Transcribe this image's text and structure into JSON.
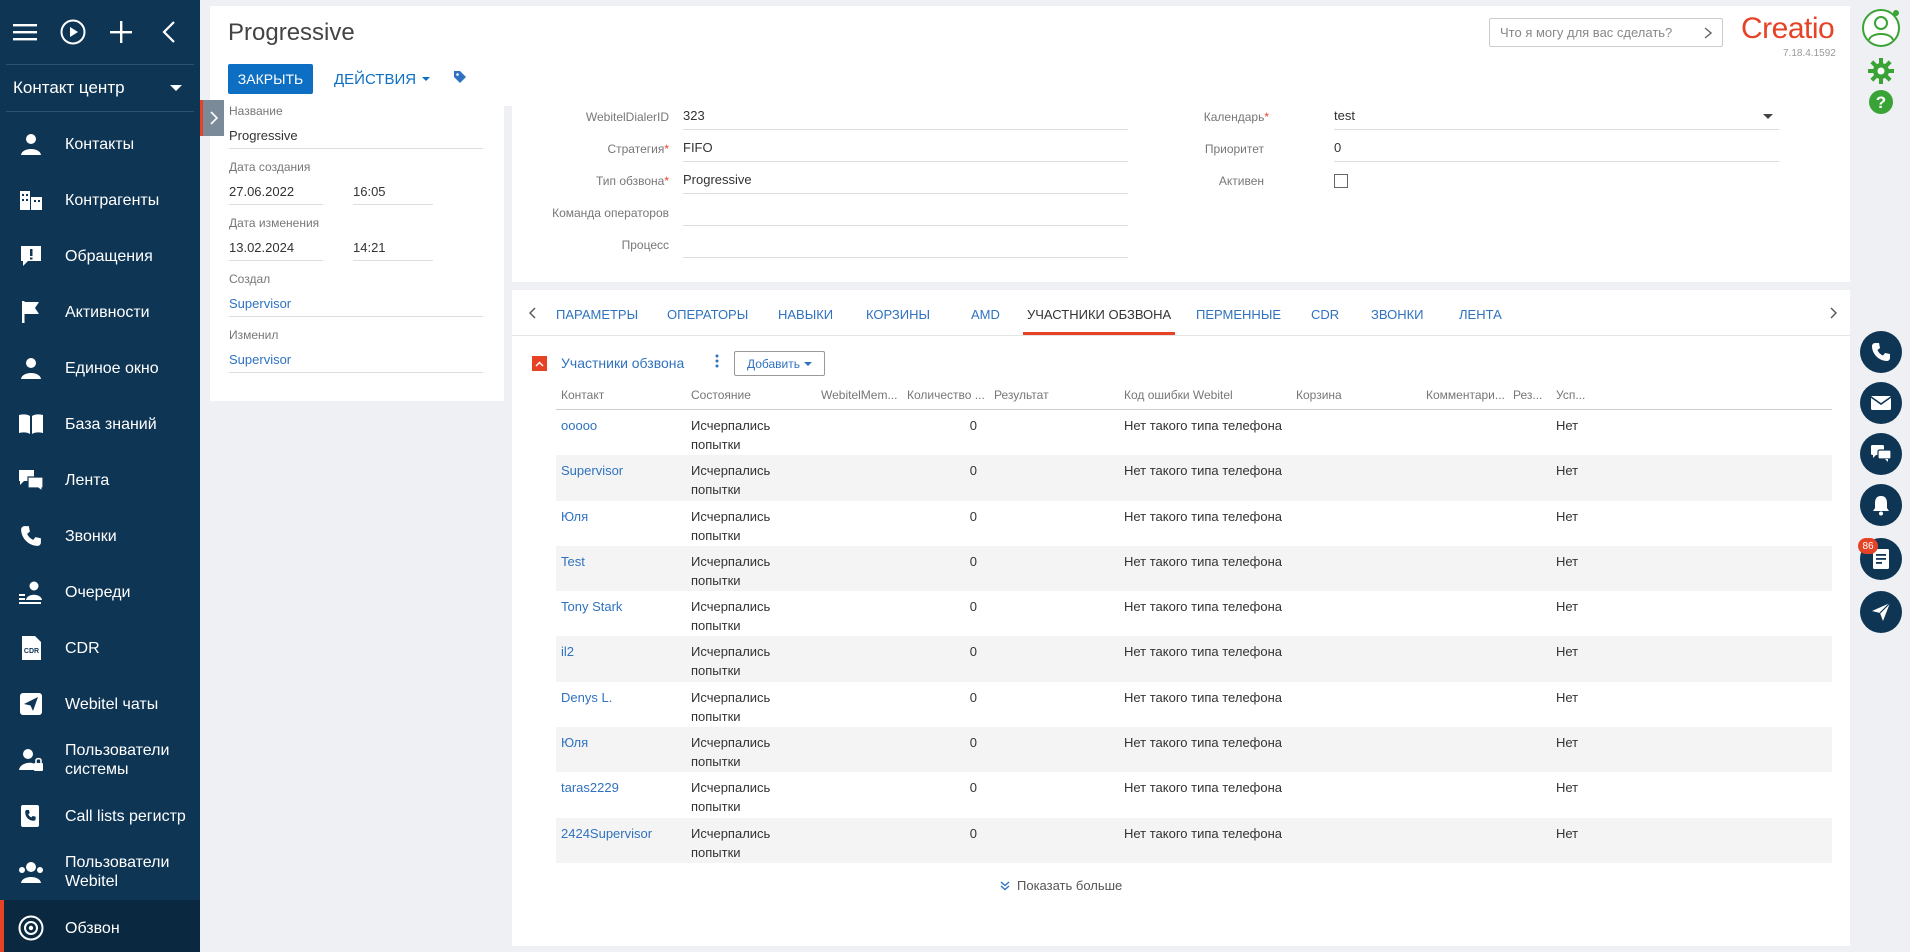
{
  "sidebar": {
    "workplace": "Контакт центр",
    "items": [
      {
        "label": "Контакты",
        "icon": "contact-icon"
      },
      {
        "label": "Контрагенты",
        "icon": "account-icon"
      },
      {
        "label": "Обращения",
        "icon": "case-icon"
      },
      {
        "label": "Активности",
        "icon": "flag-icon"
      },
      {
        "label": "Единое окно",
        "icon": "person-icon"
      },
      {
        "label": "База знаний",
        "icon": "book-icon"
      },
      {
        "label": "Лента",
        "icon": "feed-icon"
      },
      {
        "label": "Звонки",
        "icon": "phone-icon"
      },
      {
        "label": "Очереди",
        "icon": "queue-icon"
      },
      {
        "label": "CDR",
        "icon": "cdr-icon"
      },
      {
        "label": "Webitel чаты",
        "icon": "send-icon"
      },
      {
        "label": "Пользователи системы",
        "icon": "user-lock-icon"
      },
      {
        "label": "Call lists регистр",
        "icon": "phone-list-icon"
      },
      {
        "label": "Пользователи Webitel",
        "icon": "users-icon"
      },
      {
        "label": "Обзвон",
        "icon": "dialer-icon",
        "active": true
      }
    ]
  },
  "header": {
    "title": "Progressive",
    "close_label": "ЗАКРЫТЬ",
    "actions_label": "ДЕЙСТВИЯ",
    "search_placeholder": "Что я могу для вас сделать?",
    "logo": "Creatio",
    "version": "7.18.4.1592"
  },
  "info": {
    "name_label": "Название",
    "name_value": "Progressive",
    "created_label": "Дата создания",
    "created_date": "27.06.2022",
    "created_time": "16:05",
    "modified_label": "Дата изменения",
    "modified_date": "13.02.2024",
    "modified_time": "14:21",
    "created_by_label": "Создал",
    "created_by": "Supervisor",
    "modified_by_label": "Изменил",
    "modified_by": "Supervisor"
  },
  "form": {
    "dialer_id_label": "WebitelDialerID",
    "dialer_id_value": "323",
    "strategy_label": "Стратегия",
    "strategy_value": "FIFO",
    "type_label": "Тип обзвона",
    "type_value": "Progressive",
    "team_label": "Команда операторов",
    "team_value": "",
    "process_label": "Процесс",
    "process_value": "",
    "calendar_label": "Календарь",
    "calendar_value": "test",
    "priority_label": "Приоритет",
    "priority_value": "0",
    "active_label": "Активен",
    "active_checked": false
  },
  "tabs": [
    "ПАРАМЕТРЫ",
    "ОПЕРАТОРЫ",
    "НАВЫКИ",
    "КОРЗИНЫ",
    "AMD",
    "УЧАСТНИКИ ОБЗВОНА",
    "ПЕРМЕННЫЕ",
    "CDR",
    "ЗВОНКИ",
    "ЛЕНТА"
  ],
  "active_tab": "УЧАСТНИКИ ОБЗВОНА",
  "detail": {
    "title": "Участники обзвона",
    "add_label": "Добавить",
    "show_more": "Показать больше",
    "columns": [
      "Контакт",
      "Состояние",
      "WebitelMem...",
      "Количество ...",
      "Результат",
      "Код ошибки Webitel",
      "Корзина",
      "Комментари...",
      "Рез...",
      "Усп..."
    ],
    "rows": [
      {
        "contact": "ooooo",
        "state_1": "Исчерпались",
        "state_2": "попытки",
        "count": "0",
        "error": "Нет такого типа телефона",
        "success": "Нет"
      },
      {
        "contact": "Supervisor",
        "state_1": "Исчерпались",
        "state_2": "попытки",
        "count": "0",
        "error": "Нет такого типа телефона",
        "success": "Нет"
      },
      {
        "contact": "Юля",
        "state_1": "Исчерпались",
        "state_2": "попытки",
        "count": "0",
        "error": "Нет такого типа телефона",
        "success": "Нет"
      },
      {
        "contact": "Test",
        "state_1": "Исчерпались",
        "state_2": "попытки",
        "count": "0",
        "error": "Нет такого типа телефона",
        "success": "Нет"
      },
      {
        "contact": "Tony Stark",
        "state_1": "Исчерпались",
        "state_2": "попытки",
        "count": "0",
        "error": "Нет такого типа телефона",
        "success": "Нет"
      },
      {
        "contact": "il2",
        "state_1": "Исчерпались",
        "state_2": "попытки",
        "count": "0",
        "error": "Нет такого типа телефона",
        "success": "Нет"
      },
      {
        "contact": "Denys L.",
        "state_1": "Исчерпались",
        "state_2": "попытки",
        "count": "0",
        "error": "Нет такого типа телефона",
        "success": "Нет"
      },
      {
        "contact": "Юля",
        "state_1": "Исчерпались",
        "state_2": "попытки",
        "count": "0",
        "error": "Нет такого типа телефона",
        "success": "Нет"
      },
      {
        "contact": "taras2229",
        "state_1": "Исчерпались",
        "state_2": "попытки",
        "count": "0",
        "error": "Нет такого типа телефона",
        "success": "Нет"
      },
      {
        "contact": "2424Supervisor",
        "state_1": "Исчерпались",
        "state_2": "попытки",
        "count": "0",
        "error": "Нет такого типа телефона",
        "success": "Нет"
      }
    ]
  },
  "right_panel": {
    "notification_count": "86"
  },
  "colors": {
    "sidebar": "#0f3554",
    "accent": "#e64326",
    "primary": "#0d6fc4",
    "link": "#2f72c0",
    "green": "#3aa335"
  }
}
